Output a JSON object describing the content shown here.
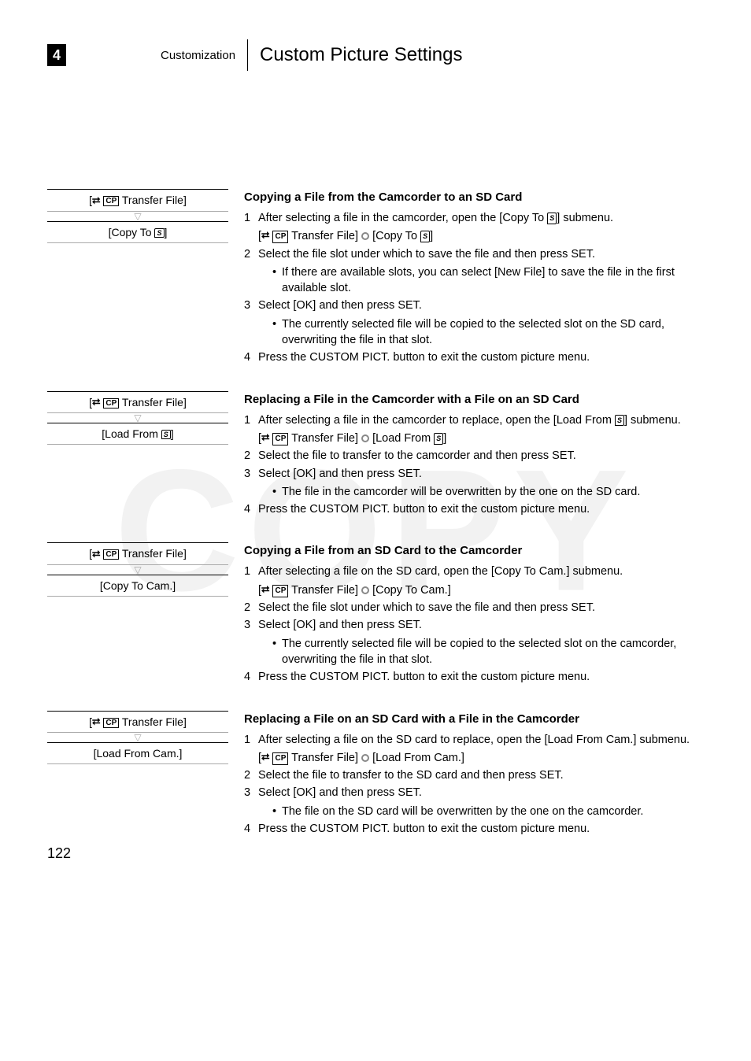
{
  "watermark": "COPY",
  "header": {
    "chapter_num": "4",
    "chapter_label": "Customization",
    "page_title": "Custom Picture Settings"
  },
  "page_number": "122",
  "icons": {
    "transfer": "⮂",
    "cp": "CP",
    "sd": "S",
    "ring": ""
  },
  "sections": [
    {
      "sidebar_top": "Transfer File]",
      "sidebar_bottom_prefix": "[Copy To ",
      "sidebar_bottom_suffix": "]",
      "sidebar_has_sd": true,
      "title": "Copying a File from the Camcorder to an SD Card",
      "steps": [
        {
          "num": "1",
          "body": "After selecting a file in the camcorder, open the [Copy To ",
          "body_suffix": "] submenu.",
          "has_sd": true,
          "path_prefix": "[",
          "path_mid": " Transfer File] ",
          "path_mid2": " [Copy To ",
          "path_end": "]",
          "path_has_sd": true
        },
        {
          "num": "2",
          "body": "Select the file slot under which to save the file and then press SET.",
          "bullets": [
            "If there are available slots, you can select [New File] to save the file in the first available slot."
          ]
        },
        {
          "num": "3",
          "body": "Select [OK] and then press SET.",
          "bullets": [
            "The currently selected file will be copied to the selected slot on the SD card, overwriting the file in that slot."
          ]
        },
        {
          "num": "4",
          "body": "Press the CUSTOM PICT. button to exit the custom picture menu."
        }
      ]
    },
    {
      "sidebar_top": "Transfer File]",
      "sidebar_bottom_prefix": "[Load From ",
      "sidebar_bottom_suffix": "]",
      "sidebar_has_sd": true,
      "title": "Replacing a File in the Camcorder with a File on an SD Card",
      "steps": [
        {
          "num": "1",
          "body": "After selecting a file in the camcorder to replace, open the [Load From ",
          "body_suffix": "] submenu.",
          "has_sd": true,
          "path_prefix": "[",
          "path_mid": " Transfer File] ",
          "path_mid2": " [Load From ",
          "path_end": "]",
          "path_has_sd": true
        },
        {
          "num": "2",
          "body": "Select the file to transfer to the camcorder and then press SET."
        },
        {
          "num": "3",
          "body": "Select [OK] and then press SET.",
          "bullets": [
            "The file in the camcorder will be overwritten by the one on the SD card."
          ]
        },
        {
          "num": "4",
          "body": "Press the CUSTOM PICT. button to exit the custom picture menu."
        }
      ]
    },
    {
      "sidebar_top": "Transfer File]",
      "sidebar_bottom_prefix": "[Copy To Cam.]",
      "sidebar_bottom_suffix": "",
      "sidebar_has_sd": false,
      "title": "Copying a File from an SD Card to the Camcorder",
      "steps": [
        {
          "num": "1",
          "body": "After selecting a file on the SD card, open the [Copy To Cam.] submenu.",
          "path_prefix": "[",
          "path_mid": " Transfer File] ",
          "path_mid2": " [Copy To Cam.]",
          "path_end": "",
          "path_has_sd": false
        },
        {
          "num": "2",
          "body": "Select the file slot under which to save the file and then press SET."
        },
        {
          "num": "3",
          "body": "Select [OK] and then press SET.",
          "bullets": [
            "The currently selected file will be copied to the selected slot on the camcorder, overwriting the file in that slot."
          ]
        },
        {
          "num": "4",
          "body": "Press the CUSTOM PICT. button to exit the custom picture menu."
        }
      ]
    },
    {
      "sidebar_top": "Transfer File]",
      "sidebar_bottom_prefix": "[Load From Cam.]",
      "sidebar_bottom_suffix": "",
      "sidebar_has_sd": false,
      "title": "Replacing a File on an SD Card with a File in the Camcorder",
      "steps": [
        {
          "num": "1",
          "body": "After selecting a file on the SD card to replace, open the [Load From Cam.] submenu.",
          "path_prefix": "[",
          "path_mid": " Transfer File] ",
          "path_mid2": " [Load From Cam.]",
          "path_end": "",
          "path_has_sd": false
        },
        {
          "num": "2",
          "body": "Select the file to transfer to the SD card and then press SET."
        },
        {
          "num": "3",
          "body": "Select [OK] and then press SET.",
          "bullets": [
            "The file on the SD card will be overwritten by the one on the camcorder."
          ]
        },
        {
          "num": "4",
          "body": "Press the CUSTOM PICT. button to exit the custom picture menu."
        }
      ]
    }
  ]
}
